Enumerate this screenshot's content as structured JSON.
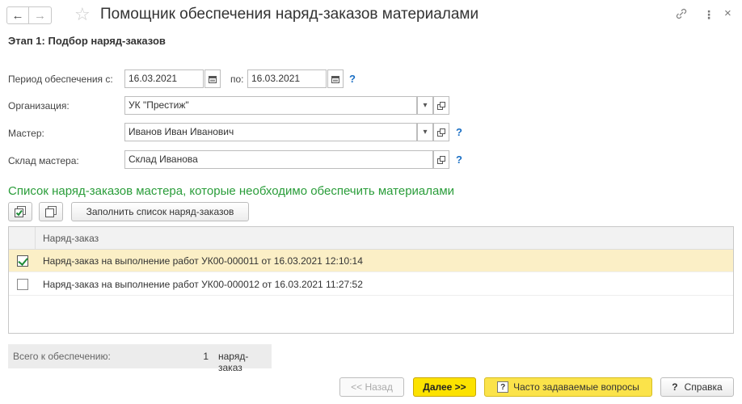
{
  "window": {
    "title": "Помощник обеспечения наряд-заказов материалами",
    "back_icon": "←",
    "forward_icon": "→",
    "star_icon": "☆",
    "link_icon": "🔗",
    "menu_icon": "⋮",
    "close_icon": "×"
  },
  "stage": "Этап 1: Подбор наряд-заказов",
  "form": {
    "period_label": "Период обеспечения с:",
    "period_from": "16.03.2021",
    "period_to_label": "по:",
    "period_to": "16.03.2021",
    "org_label": "Организация:",
    "org_value": "УК \"Престиж\"",
    "master_label": "Мастер:",
    "master_value": "Иванов Иван Иванович",
    "warehouse_label": "Склад мастера:",
    "warehouse_value": "Склад Иванова",
    "help": "?"
  },
  "list": {
    "heading": "Список наряд-заказов мастера, которые необходимо обеспечить материалами",
    "fill_button": "Заполнить список наряд-заказов",
    "column": "Наряд-заказ",
    "rows": [
      {
        "checked": true,
        "text": "Наряд-заказ на выполнение работ УК00-000011 от 16.03.2021 12:10:14"
      },
      {
        "checked": false,
        "text": "Наряд-заказ на выполнение работ УК00-000012 от 16.03.2021 11:27:52"
      }
    ]
  },
  "total": {
    "label": "Всего к обеспечению:",
    "value": "1",
    "unit": "наряд-заказ"
  },
  "buttons": {
    "back": "<< Назад",
    "next": "Далее >>",
    "faq": "Часто задаваемые вопросы",
    "help": "Справка",
    "q": "?"
  }
}
